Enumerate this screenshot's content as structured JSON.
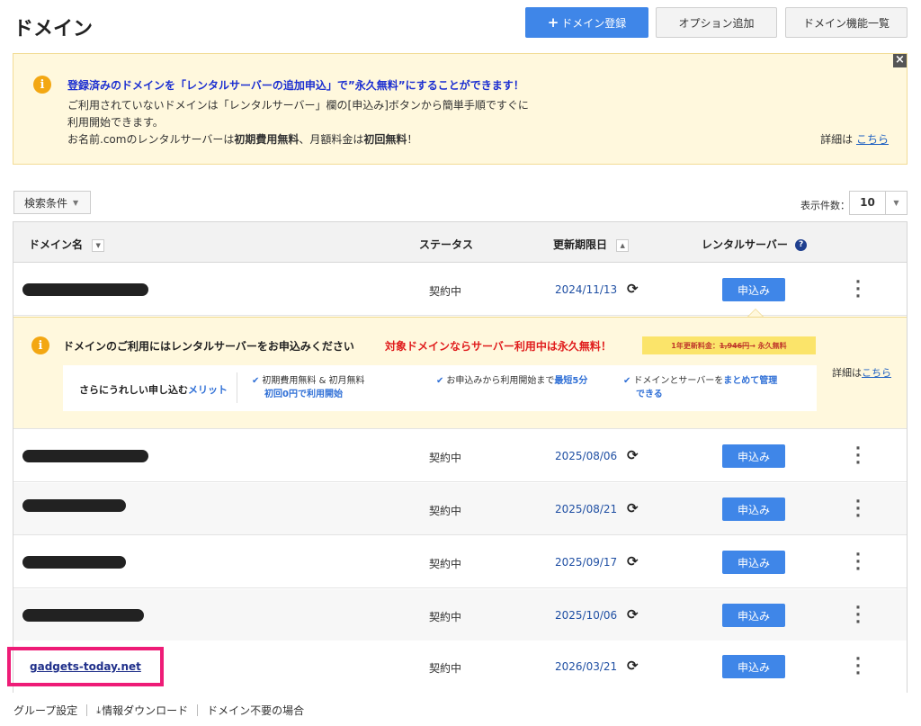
{
  "page": {
    "title": "ドメイン"
  },
  "header_buttons": {
    "register_plus": "+",
    "register": "ドメイン登録",
    "option": "オプション追加",
    "features": "ドメイン機能一覧"
  },
  "notice": {
    "icon": "info-icon",
    "title": "登録済みのドメインを「レンタルサーバーの追加申込」で”永久無料”にすることができます！",
    "line1": "ご利用されていないドメインは「レンタルサーバー」欄の[申込み]ボタンから簡単手順ですぐに",
    "line2": "利用開始できます。",
    "line3_a": "お名前.comのレンタルサーバーは",
    "line3_b": "初期費用無料",
    "line3_c": "、月額料金は",
    "line3_d": "初回無料",
    "line3_e": "！",
    "more_label": "詳細は",
    "more_link": "こちら",
    "close": "×"
  },
  "filters": {
    "search_conditions": "検索条件",
    "per_page_label": "表示件数：",
    "per_page_value": "10"
  },
  "table": {
    "headers": {
      "domain": "ドメイン名",
      "status": "ステータス",
      "expiry": "更新期限日",
      "server": "レンタルサーバー",
      "help": "?"
    },
    "rows": [
      {
        "domain": "",
        "status": "契約中",
        "expiry": "2024/11/13",
        "apply": "申込み"
      },
      {
        "domain": "",
        "status": "契約中",
        "expiry": "2025/08/06",
        "apply": "申込み"
      },
      {
        "domain": "",
        "status": "契約中",
        "expiry": "2025/08/21",
        "apply": "申込み"
      },
      {
        "domain": "",
        "status": "契約中",
        "expiry": "2025/09/17",
        "apply": "申込み"
      },
      {
        "domain": "",
        "status": "契約中",
        "expiry": "2025/10/06",
        "apply": "申込み"
      },
      {
        "domain": "gadgets-today.net",
        "status": "契約中",
        "expiry": "2026/03/21",
        "apply": "申込み"
      }
    ],
    "renew_icon": "refresh-icon",
    "menu_icon": "kebab-menu-icon"
  },
  "promo": {
    "title": "ドメインのご利用にはレンタルサーバーをお申込みください",
    "free": "対象ドメインならサーバー利用中は永久無料！",
    "fee_prefix": "1年更新料金：",
    "fee_old": "1,946円",
    "fee_suffix": " → 永久無料",
    "more_label": "詳細は",
    "more_link": "こちら",
    "merit_title_a": "さらにうれしい申し込む",
    "merit_title_b": "メリット",
    "merit1_line1": "初期費用無料 & 初月無料",
    "merit1_line2": "初回0円で利用開始",
    "merit2_a": "お申込みから利用開始まで",
    "merit2_b": "最短5分",
    "merit3_a": "ドメインとサーバーを",
    "merit3_b": "まとめて管理",
    "merit3_c": "できる",
    "check": "✔"
  },
  "footer": {
    "group": "グループ設定",
    "download": "情報ダウンロード",
    "unneeded": "ドメイン不要の場合"
  },
  "colors": {
    "primary": "#3f86e8",
    "notice_bg": "#fff8dd",
    "highlight": "#ee1c77",
    "link": "#1f2f8a"
  }
}
